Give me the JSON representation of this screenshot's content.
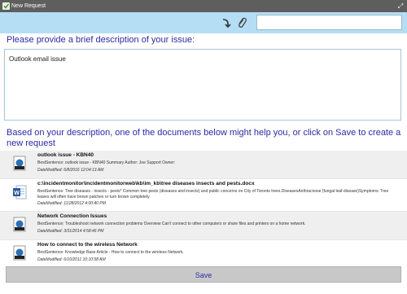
{
  "window": {
    "title": "New Request"
  },
  "toolbar": {
    "search_value": ""
  },
  "form": {
    "description_prompt": "Please provide a brief description of your issue:",
    "description_value": "Outlook email issue",
    "suggestion_text": "Based on your description, one of the documents below might help you, or click on Save to create a new request"
  },
  "results": [
    {
      "title": "outlook issue - KBN40",
      "sentence": "BestSentence: outlook issue - KBN40 Summary Author: Joe Support Owner:",
      "date": "DateModified: 6/8/2016 12:04:13 AM",
      "icon": "web-document-icon"
    },
    {
      "title": "c:\\incidentmonitor\\incidentmonitorweb\\kb\\im_kb\\tree diseases insects and pests.docx",
      "sentence": "BestSentence: Tree diseases - insects - pests* Common tree pests (diseases and insects) and public concerns on City of Toronto trees.DiseasesAnthracnose (fungal leaf disease)Symptoms: Tree leaves will often have brown patches or turn brown completely.",
      "date": "DateModified: 11/28/2012 4:00:40 PM",
      "icon": "word-document-icon"
    },
    {
      "title": "Network Connection Issues",
      "sentence": "BestSentence: Troubleshoot network connection problems Overview Can't connect to other computers or share files and printers on a home network.",
      "date": "DateModified: 3/31/2014 4:58:46 PM",
      "icon": "web-document-icon"
    },
    {
      "title": "How to connect to the wireless Network",
      "sentence": "BestSentence: Knowledge Base Article - How to connect to the wireless Network.",
      "date": "DateModified: 6/10/2011 10:10:58 AM",
      "icon": "web-document-icon"
    }
  ],
  "actions": {
    "save_label": "Save"
  },
  "colors": {
    "titlebar": "#5e5e5e",
    "toolbar": "#b5def5",
    "accent_text": "#2b2ba6",
    "save_button": "#c8c8c8"
  }
}
